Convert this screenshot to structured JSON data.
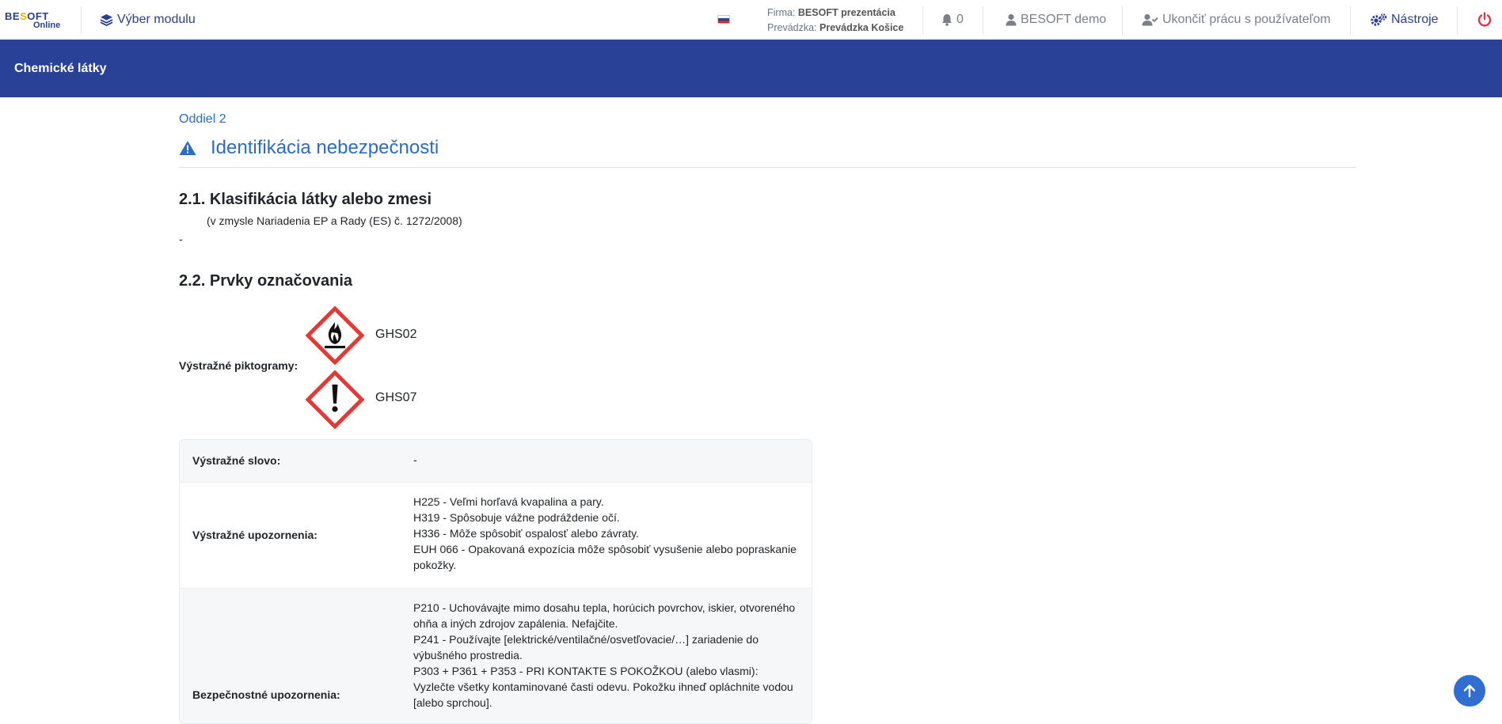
{
  "nav": {
    "logo_main_1": "BE",
    "logo_main_o": "S",
    "logo_main_2": "OFT",
    "logo_sub": "Online",
    "module_label": "Výber modulu",
    "firm_label": "Firma:",
    "firm_value": "BESOFT prezentácia",
    "branch_label": "Prevádzka:",
    "branch_value": "Prevádzka Košice",
    "notifications": "0",
    "user": "BESOFT demo",
    "end_work": "Ukončiť prácu s používateľom",
    "tools": "Nástroje"
  },
  "header": {
    "title": "Chemické látky"
  },
  "section": {
    "label": "Oddiel 2",
    "title": "Identifikácia nebezpečnosti",
    "h21": "2.1. Klasifikácia látky alebo zmesi",
    "h21_sub": "(v zmysle Nariadenia EP a Rady (ES) č. 1272/2008)",
    "h21_value": "-",
    "h22": "2.2. Prvky označovania",
    "pictograms_label": "Výstražné piktogramy:",
    "pictograms": [
      {
        "code": "GHS02",
        "icon": "flame-icon"
      },
      {
        "code": "GHS07",
        "icon": "exclamation-icon"
      }
    ]
  },
  "table": {
    "signal_word_label": "Výstražné slovo:",
    "signal_word_value": "-",
    "hazard_label": "Výstražné upozornenia:",
    "hazard_lines": [
      "H225 - Veľmi horľavá kvapalina a pary.",
      "H319 - Spôsobuje vážne podráždenie očí.",
      "H336 - Môže spôsobiť ospalosť alebo závraty.",
      "EUH 066 - Opakovaná expozícia môže spôsobiť vysušenie alebo popraskanie pokožky."
    ],
    "precaution_label": "Bezpečnostné upozornenia:",
    "precaution_lines": [
      "P210 - Uchovávajte mimo dosahu tepla, horúcich povrchov, iskier, otvoreného ohňa a iných zdrojov zapálenia. Nefajčite.",
      "P241 - Používajte [elektrické/ventilačné/osvetľovacie/…] zariadenie do výbušného prostredia.",
      "P303 + P361 + P353 - PRI KONTAKTE S POKOŽKOU (alebo vlasmi): Vyzlečte všetky kontaminované časti odevu. Pokožku ihneď opláchnite vodou [alebo sprchou]."
    ]
  },
  "colors": {
    "brand_blue": "#294297",
    "link_blue": "#2b6cc4",
    "ghs_red": "#e53935",
    "power_red": "#dc3545"
  }
}
